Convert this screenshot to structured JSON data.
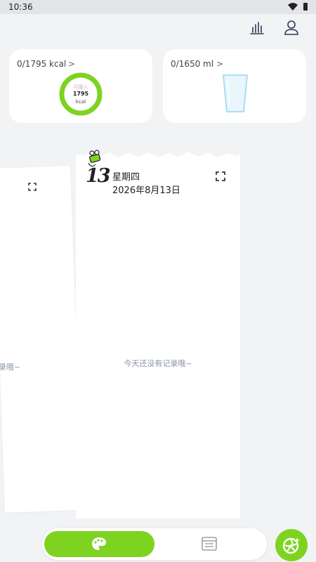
{
  "status": {
    "time": "10:36"
  },
  "calorie_card": {
    "title": "0/1795 kcal",
    "chevron": ">",
    "ring_label": "可摄入",
    "ring_value": "1795",
    "ring_unit": "kcal",
    "ring_progress": 1.0,
    "accent": "#7ed321"
  },
  "water_card": {
    "title": "0/1650 ml",
    "chevron": ">",
    "cup_fill": 0
  },
  "diary_main": {
    "day": "13",
    "weekday": "星期四",
    "date": "2026年8月13日",
    "empty_text": "今天还没有记录哦~"
  },
  "diary_back": {
    "empty_text": "录哦~"
  },
  "nav": {
    "active_tab": "palette"
  }
}
